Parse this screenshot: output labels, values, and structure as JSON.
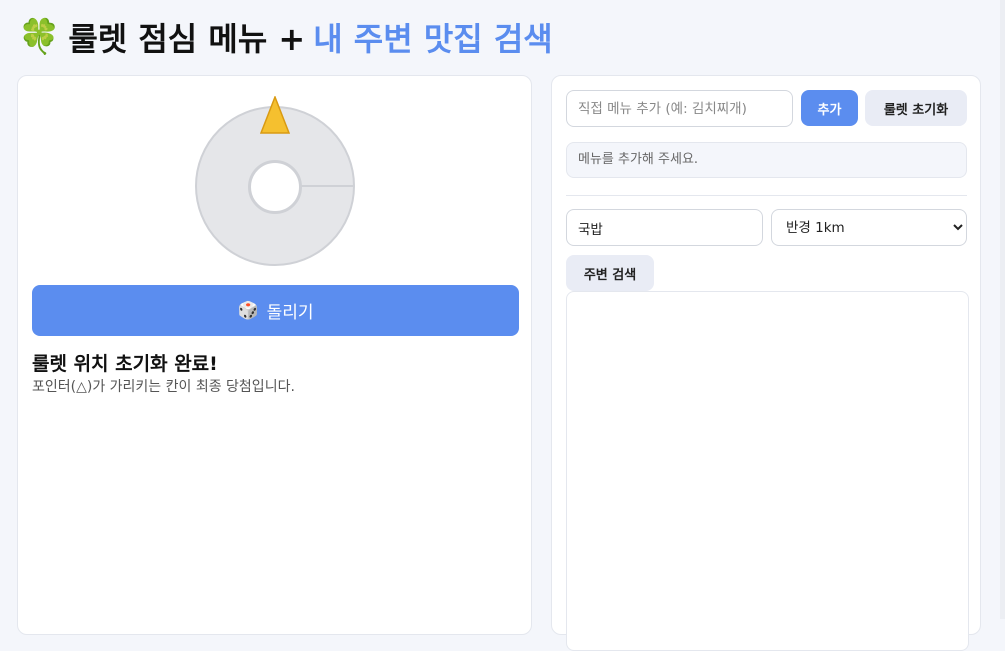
{
  "header": {
    "icon": "four-leaf-clover-icon",
    "title_main": "룰렛 점심 메뉴 +",
    "title_accent": "내 주변 맛집 검색",
    "accent_color": "#5b8def"
  },
  "roulette": {
    "spin_icon": "dice-icon",
    "spin_label": "돌리기",
    "result_title": "룰렛 위치 초기화 완료!",
    "result_desc": "포인터(△)가 가리키는 칸이 최종 당첨입니다."
  },
  "menu": {
    "input_placeholder": "직접 메뉴 추가 (예: 김치찌개)",
    "add_label": "추가",
    "reset_label": "룰렛 초기화",
    "empty_hint": "메뉴를 추가해 주세요."
  },
  "search": {
    "keyword_value": "국밥",
    "radius_selected": "반경 1km",
    "search_label": "주변 검색"
  }
}
